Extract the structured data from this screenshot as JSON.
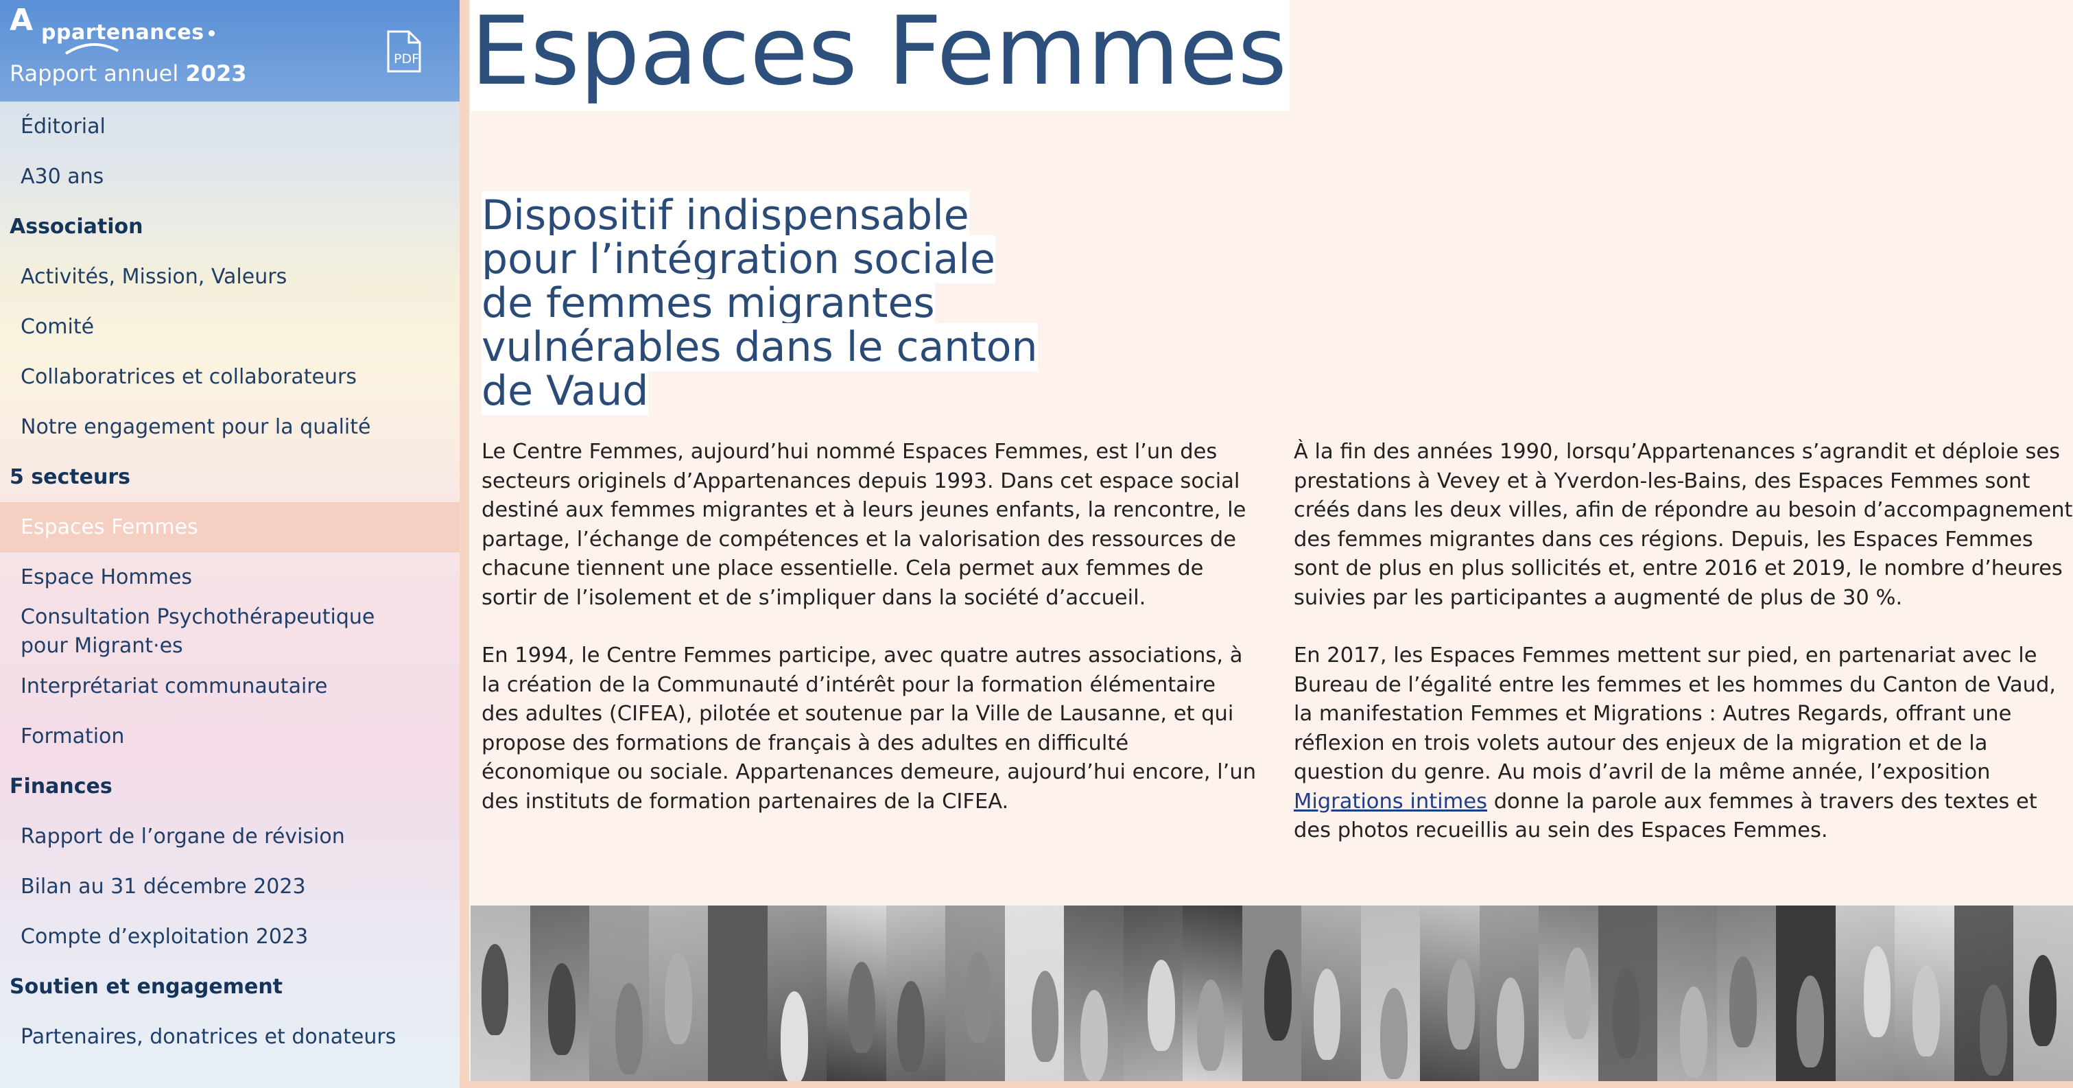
{
  "sidebar": {
    "logo_letter": "A",
    "logo_text": "ppartenances",
    "report_prefix": "Rapport annuel",
    "report_year": "2023",
    "pdf_icon": "pdf-icon",
    "nav": [
      {
        "label": "Éditorial"
      },
      {
        "label": "A30 ans"
      },
      {
        "label": "Association"
      },
      {
        "label": "Activités, Mission, Valeurs"
      },
      {
        "label": "Comité"
      },
      {
        "label": "Collaboratrices et collaborateurs"
      },
      {
        "label": "Notre engagement pour la qualité"
      },
      {
        "label": "5 secteurs"
      },
      {
        "label": "Espaces Femmes"
      },
      {
        "label": "Espace Hommes"
      },
      {
        "label": "Consultation Psychothérapeutique pour Migrant·es"
      },
      {
        "label": "Interprétariat communautaire"
      },
      {
        "label": "Formation"
      },
      {
        "label": "Finances"
      },
      {
        "label": "Rapport de l’organe de révision"
      },
      {
        "label": "Bilan au 31 décembre 2023"
      },
      {
        "label": "Compte d’exploitation 2023"
      },
      {
        "label": "Soutien et engagement"
      },
      {
        "label": "Partenaires, donatrices et donateurs"
      }
    ]
  },
  "main": {
    "title": "Espaces Femmes",
    "subtitle": "Dispositif indispensable pour l’intégration sociale de femmes migrantes vulnérables dans le canton de Vaud",
    "left_col": [
      "Le Centre Femmes, aujourd’hui nommé Espaces Femmes, est l’un des secteurs originels d’Appartenances depuis 1993. Dans cet espace social destiné aux femmes migrantes et à leurs jeunes enfants, la rencontre, le partage, l’échange de compétences et la valorisation des ressources de chacune tiennent une place essentielle. Cela permet aux femmes de sortir de l’isolement et de s’impliquer dans la société d’accueil.",
      "En 1994, le Centre Femmes participe, avec quatre autres associations, à la création de la Communauté d’intérêt pour la formation élémentaire des adultes (CIFEA), pilotée et soutenue par la Ville de Lausanne, et qui propose des formations de français à des adultes en difficulté économique ou sociale. Appartenances demeure, aujourd’hui encore, l’un des instituts de formation partenaires de la CIFEA."
    ],
    "right_col_p1": "À la fin des années 1990, lorsqu’Appartenances s’agrandit et déploie ses prestations à Vevey et à Yverdon-les-Bains, des Espaces Femmes sont créés dans les deux villes, afin de répondre au besoin d’accompagnement des femmes migrantes dans ces régions. Depuis, les Espaces Femmes sont de plus en plus sollicités et, entre 2016 et 2019, le nombre d’heures suivies par les participantes a augmenté de plus de 30 %.",
    "right_col_p2_before": "En 2017, les Espaces Femmes mettent sur pied, en partenariat avec le Bureau de l’égalité entre les femmes et les hommes du Canton de Vaud, la manifestation Femmes et Migrations : Autres Regards, offrant une réflexion en trois volets autour des enjeux de la migration et de la question du genre. Au mois d’avril de la même année, l’exposition ",
    "right_col_p2_link": "Migrations intimes",
    "right_col_p2_after": " donne la parole aux femmes à travers des textes et des photos recueillis au sein des Espaces Femmes."
  },
  "colors": {
    "header_blue": "#5a8fd6",
    "title_blue": "#2d4f7c",
    "active_item_bg": "#f5cfc2",
    "page_bg": "#fdf3ec"
  }
}
